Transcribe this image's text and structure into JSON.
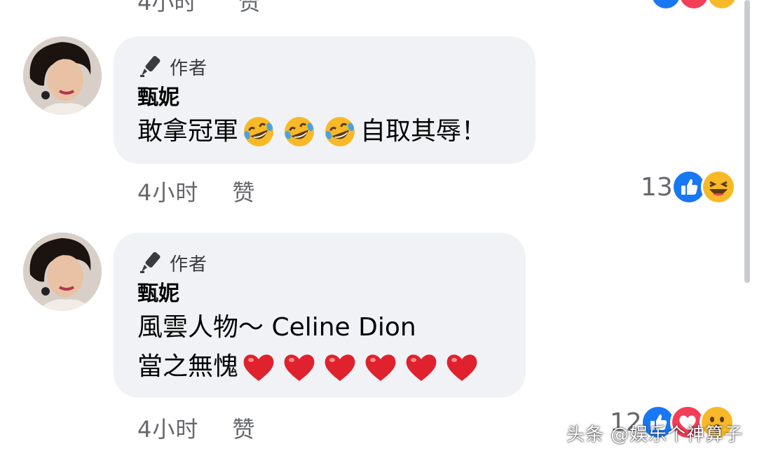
{
  "comments": [
    {
      "badge": "作者",
      "name": "甄妮",
      "lines": [
        {
          "segments": [
            {
              "text": "敢拿冠軍"
            },
            {
              "emoji": "rofl-emoji",
              "repeat": 3
            },
            {
              "text": "自取其辱！"
            }
          ]
        }
      ],
      "time": "4小时",
      "like_label": "赞",
      "reaction_count": "13",
      "reactions": [
        "like-icon",
        "haha-icon"
      ]
    },
    {
      "badge": "作者",
      "name": "甄妮",
      "lines": [
        {
          "segments": [
            {
              "text": "風雲人物～ Celine Dion"
            }
          ]
        },
        {
          "segments": [
            {
              "text": "當之無愧"
            },
            {
              "emoji": "red-heart-emoji",
              "repeat": 6
            }
          ]
        }
      ],
      "time": "4小时",
      "like_label": "赞",
      "reaction_count": "12",
      "reactions": [
        "like-icon",
        "love-icon",
        "wow-icon"
      ]
    }
  ],
  "watermark": "头条 @娱乐个神算子",
  "colors": {
    "bubble": "#f0f2f5",
    "meta_text": "#65676b",
    "like_blue": "#1877f2",
    "love_red": "#f33e58",
    "emoji_yellow": "#f7b928"
  }
}
